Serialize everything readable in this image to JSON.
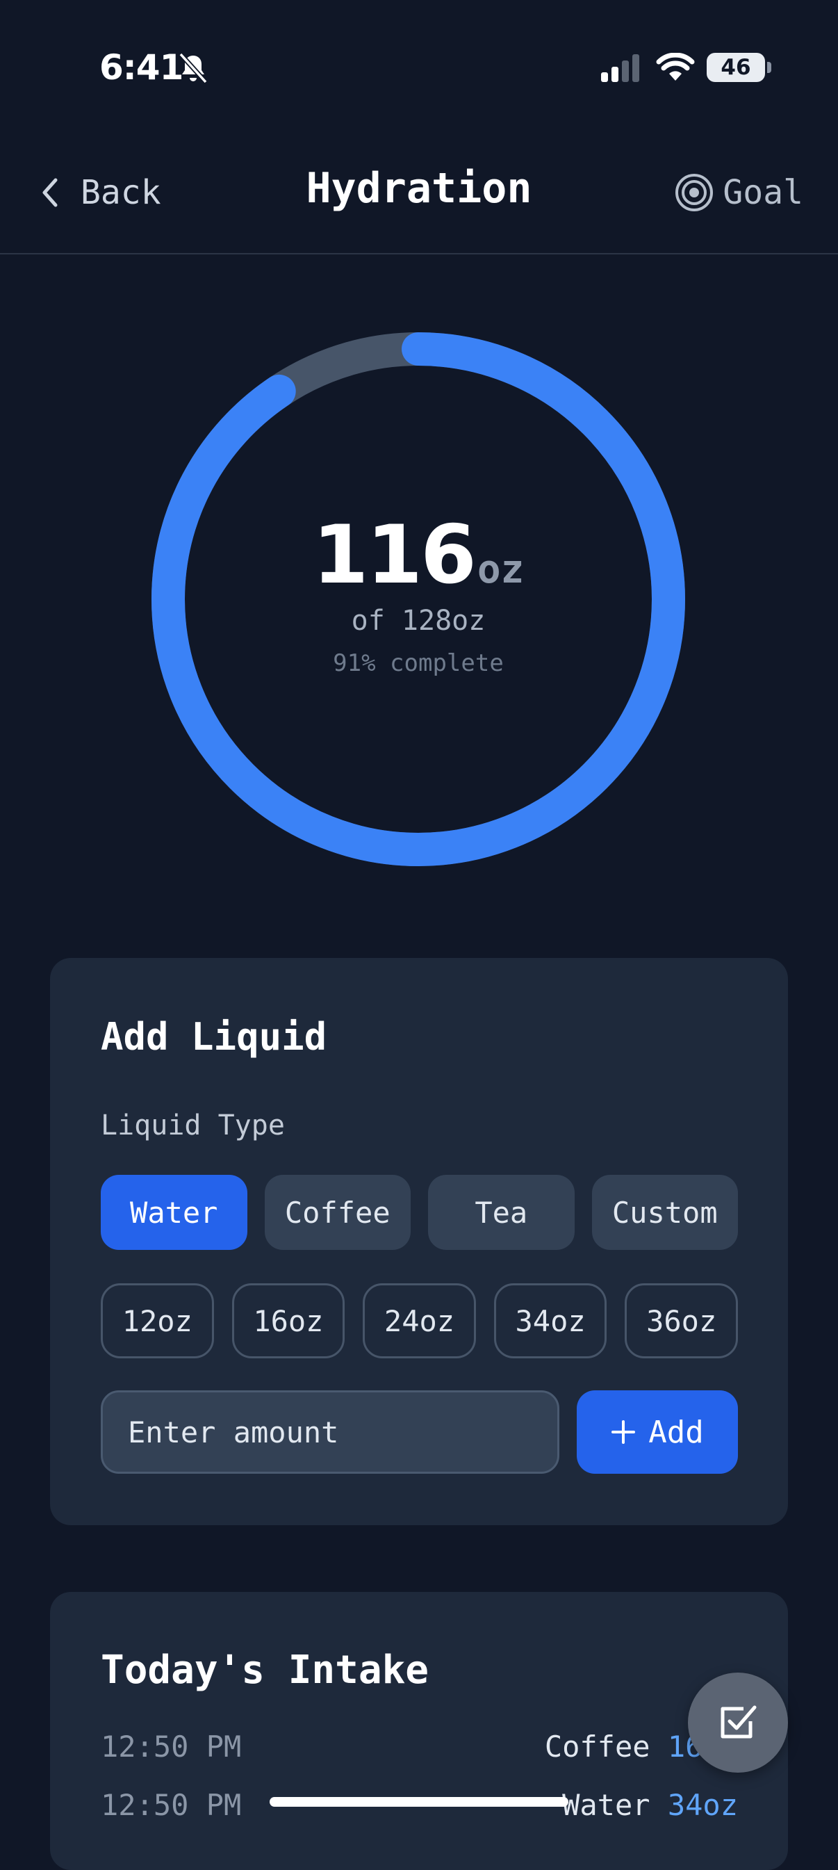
{
  "status_bar": {
    "time": "6:41",
    "battery": "46"
  },
  "header": {
    "back_label": "Back",
    "title": "Hydration",
    "goal_label": "Goal"
  },
  "progress": {
    "current": "116",
    "unit": "oz",
    "goal_text": "of 128oz",
    "percent_text": "91% complete",
    "fraction": 0.906,
    "ring_color": "#3b82f6",
    "track_color": "#475569"
  },
  "add_liquid": {
    "title": "Add Liquid",
    "type_label": "Liquid Type",
    "types": [
      {
        "label": "Water",
        "active": true
      },
      {
        "label": "Coffee",
        "active": false
      },
      {
        "label": "Tea",
        "active": false
      },
      {
        "label": "Custom",
        "active": false
      }
    ],
    "sizes": [
      "12oz",
      "16oz",
      "24oz",
      "34oz",
      "36oz"
    ],
    "amount_placeholder": "Enter amount",
    "add_label": "Add",
    "accent": "#2563eb"
  },
  "intake": {
    "title": "Today's Intake",
    "entries": [
      {
        "time": "12:50 PM",
        "name": "Coffee",
        "amount": "16oz"
      },
      {
        "time": "12:50 PM",
        "name": "Water",
        "amount": "34oz"
      }
    ]
  },
  "icons": {
    "back": "chevron-left-icon",
    "goal": "target-icon",
    "add": "plus-icon",
    "fab": "checkbox-icon"
  }
}
